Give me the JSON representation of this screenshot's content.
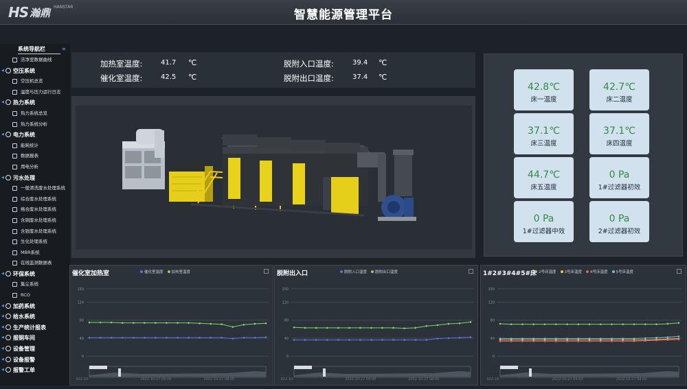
{
  "header": {
    "logo_hs": "HS",
    "logo_cn": "瀚鼎",
    "logo_en": "HANSTAR",
    "title": "智慧能源管理平台"
  },
  "sidebar": {
    "title": "系统导航栏",
    "collapse_icon": "«",
    "items": [
      {
        "type": "sub",
        "label": "洁净室数据曲线"
      },
      {
        "type": "group",
        "label": "空压系统"
      },
      {
        "type": "sub",
        "label": "空压机总览"
      },
      {
        "type": "sub",
        "label": "温度与压力运行日志"
      },
      {
        "type": "group",
        "label": "热力系统"
      },
      {
        "type": "sub",
        "label": "热力系统总览"
      },
      {
        "type": "sub",
        "label": "热力系统分析"
      },
      {
        "type": "group",
        "label": "电力系统"
      },
      {
        "type": "sub",
        "label": "能耗统计"
      },
      {
        "type": "sub",
        "label": "数据报表"
      },
      {
        "type": "sub",
        "label": "用电分析"
      },
      {
        "type": "group",
        "label": "污水处理"
      },
      {
        "type": "sub",
        "label": "一般清洗废水处理系统"
      },
      {
        "type": "sub",
        "label": "综合废水处理系统"
      },
      {
        "type": "sub",
        "label": "络合废水处理系统"
      },
      {
        "type": "sub",
        "label": "含铜废水处理系统"
      },
      {
        "type": "sub",
        "label": "含银废水处理系统"
      },
      {
        "type": "sub",
        "label": "生化处理系统"
      },
      {
        "type": "sub",
        "label": "MBR系统"
      },
      {
        "type": "sub",
        "label": "在线监测数据表"
      },
      {
        "type": "group",
        "label": "环保系统"
      },
      {
        "type": "sub",
        "label": "集尘系统"
      },
      {
        "type": "sub",
        "label": "RCO"
      },
      {
        "type": "group",
        "label": "加药系统"
      },
      {
        "type": "group",
        "label": "给水系统"
      },
      {
        "type": "group",
        "label": "生产统计报表"
      },
      {
        "type": "group",
        "label": "报铜车间"
      },
      {
        "type": "group",
        "label": "设备管理"
      },
      {
        "type": "group",
        "label": "设备报警"
      },
      {
        "type": "group",
        "label": "报警工单"
      }
    ]
  },
  "readings": {
    "heat_room_label": "加热室温度:",
    "heat_room_value": "41.7",
    "catalyst_room_label": "催化室温度:",
    "catalyst_room_value": "42.5",
    "desorb_in_label": "脱附入口温度:",
    "desorb_in_value": "39.4",
    "desorb_out_label": "脱附出口温度:",
    "desorb_out_value": "37.4",
    "unit": "℃"
  },
  "cards": [
    {
      "value": "42.8℃",
      "label": "床一温度"
    },
    {
      "value": "42.7℃",
      "label": "床二温度"
    },
    {
      "value": "37.1℃",
      "label": "床三温度"
    },
    {
      "value": "37.1℃",
      "label": "床四温度"
    },
    {
      "value": "44.7℃",
      "label": "床五温度"
    },
    {
      "value": "0  Pa",
      "label": "1#过滤器初效"
    },
    {
      "value": "0  Pa",
      "label": "1#过滤器中效"
    },
    {
      "value": "0  Pa",
      "label": "2#过滤器初效"
    }
  ],
  "colors": {
    "green": "#86d46a",
    "blue": "#5677e8",
    "yellow": "#f2c54a",
    "red": "#ef5a5a",
    "cyan": "#73c0de"
  },
  "chart_data": [
    {
      "type": "line",
      "title": "催化室加热室",
      "yticks": [
        0,
        40,
        80,
        120,
        150
      ],
      "ylim": [
        0,
        150
      ],
      "xtick_labels": [
        "022-10-",
        "2022-10-27 04:00",
        "2022-10-27 08:00"
      ],
      "series": [
        {
          "name": "催化室温度",
          "color": "#5677e8",
          "values": [
            41,
            41,
            41,
            41,
            41,
            41,
            41,
            41,
            41,
            41,
            41,
            41,
            41,
            39,
            41,
            41,
            42
          ]
        },
        {
          "name": "加热室温度",
          "color": "#86d46a",
          "values": [
            75,
            75,
            75,
            74,
            74,
            74,
            74,
            74,
            74,
            74,
            73,
            72,
            71,
            65,
            70,
            72,
            73
          ]
        }
      ]
    },
    {
      "type": "line",
      "title": "脱附出入口",
      "yticks": [
        0,
        40,
        80,
        120,
        150
      ],
      "ylim": [
        0,
        150
      ],
      "xtick_labels": [
        "022-10-",
        "2022-10-27 04:00",
        "2022-10-27 08:00"
      ],
      "series": [
        {
          "name": "脱附入口温度",
          "color": "#5677e8",
          "values": [
            36,
            36,
            36,
            36,
            36,
            36,
            36,
            36,
            36,
            36,
            36,
            36,
            36,
            39,
            40,
            41,
            42
          ]
        },
        {
          "name": "脱附出口温度",
          "color": "#86d46a",
          "values": [
            64,
            63,
            63,
            63,
            63,
            63,
            63,
            63,
            63,
            63,
            62,
            63,
            67,
            69,
            72,
            73,
            76
          ]
        }
      ]
    },
    {
      "type": "line",
      "title": "1#2#3#4#5#床",
      "yticks": [
        0,
        40,
        80,
        120,
        150
      ],
      "ylim": [
        0,
        150
      ],
      "xtick_labels": [
        "022-10-",
        "2022-10-27 04:00",
        "2022-10-27 08:00"
      ],
      "series": [
        {
          "name": "2号床温度",
          "color": "#86d46a",
          "values": [
            72,
            71,
            71,
            71,
            71,
            71,
            71,
            71,
            71,
            71,
            71,
            71,
            71,
            71,
            71,
            72,
            74
          ]
        },
        {
          "name": "3号床温度",
          "color": "#f2c54a",
          "values": [
            36,
            36,
            36,
            36,
            36,
            36,
            36,
            36,
            36,
            36,
            36,
            36,
            36,
            36,
            37,
            38,
            39
          ]
        },
        {
          "name": "4号床温度",
          "color": "#ef5a5a",
          "values": [
            33,
            33,
            33,
            33,
            33,
            33,
            33,
            33,
            33,
            33,
            33,
            33,
            33,
            34,
            35,
            36,
            37
          ]
        },
        {
          "name": "5号床温度",
          "color": "#73c0de",
          "values": [
            39,
            39,
            39,
            39,
            39,
            39,
            39,
            39,
            39,
            39,
            39,
            39,
            39,
            40,
            41,
            42,
            44
          ]
        }
      ]
    }
  ]
}
